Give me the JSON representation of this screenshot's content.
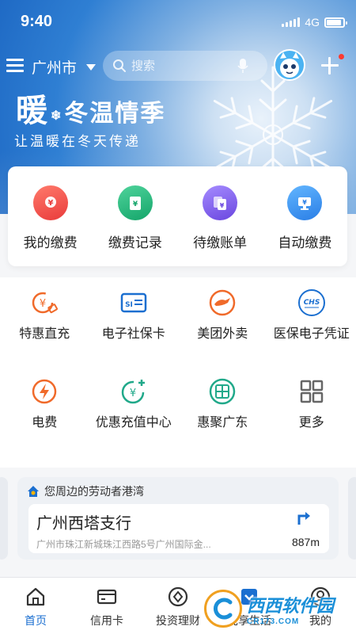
{
  "status_bar": {
    "time": "9:40",
    "network": "4G"
  },
  "header": {
    "city": "广州市",
    "search_placeholder": "搜索",
    "icons": [
      "menu-icon",
      "city-caret-icon",
      "search-icon",
      "mic-icon",
      "mascot-avatar",
      "add-icon"
    ]
  },
  "banner": {
    "title_big": "暖",
    "title_rest": "冬温情季",
    "subtitle": "让温暖在冬天传递"
  },
  "quick_actions": [
    {
      "label": "我的缴费",
      "icon": "my-payment-icon",
      "color": "#f04e4e"
    },
    {
      "label": "缴费记录",
      "icon": "payment-record-icon",
      "color": "#21b47a"
    },
    {
      "label": "待缴账单",
      "icon": "pending-bill-icon",
      "color": "#7a5be6"
    },
    {
      "label": "自动缴费",
      "icon": "auto-payment-icon",
      "color": "#2f8fe8"
    }
  ],
  "services": [
    {
      "label": "特惠直充",
      "icon": "discount-recharge-icon",
      "color": "#f06a2a"
    },
    {
      "label": "电子社保卡",
      "icon": "social-security-card-icon",
      "color": "#1b6fd0"
    },
    {
      "label": "美团外卖",
      "icon": "meituan-delivery-icon",
      "color": "#f06a2a"
    },
    {
      "label": "医保电子凭证",
      "icon": "medical-insurance-icon",
      "color": "#1b6fd0"
    },
    {
      "label": "电费",
      "icon": "electricity-icon",
      "color": "#f06a2a"
    },
    {
      "label": "优惠充值中心",
      "icon": "recharge-center-icon",
      "color": "#21a98a"
    },
    {
      "label": "惠聚广东",
      "icon": "huiju-guangdong-icon",
      "color": "#21a98a"
    },
    {
      "label": "更多",
      "icon": "more-grid-icon",
      "color": "#666666"
    }
  ],
  "nearby": {
    "heading": "您周边的劳动者港湾",
    "branch_name": "广州西塔支行",
    "address": "广州市珠江新城珠江西路5号广州国际金...",
    "distance": "887m"
  },
  "tabbar": [
    {
      "label": "首页",
      "icon": "home-icon"
    },
    {
      "label": "信用卡",
      "icon": "credit-card-icon"
    },
    {
      "label": "投资理财",
      "icon": "investment-icon"
    },
    {
      "label": "优享生活",
      "icon": "life-icon"
    },
    {
      "label": "我的",
      "icon": "profile-icon"
    }
  ],
  "watermark": {
    "main": "西西软件园",
    "sub": "CR173.COM"
  },
  "colors": {
    "primary": "#1b6fd0",
    "notification_dot": "#ff3b30"
  }
}
